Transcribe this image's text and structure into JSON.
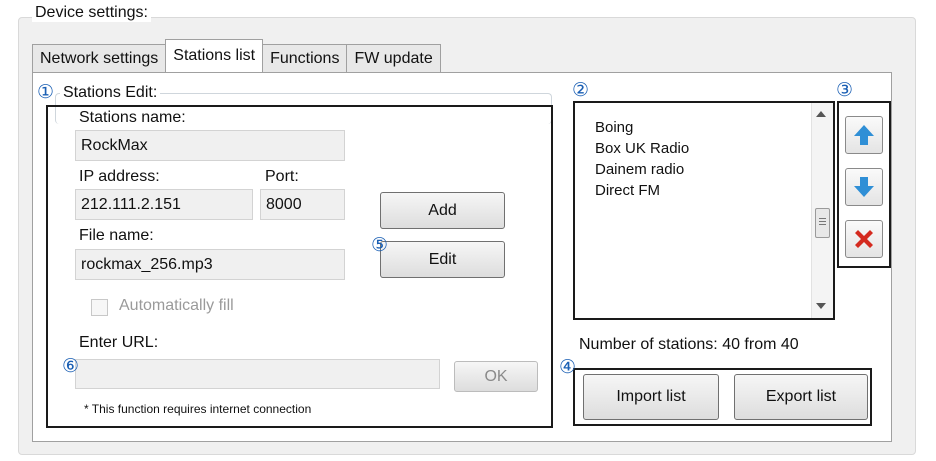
{
  "window": {
    "group_title": "Device settings:"
  },
  "tabs": [
    {
      "label": "Network settings",
      "active": false
    },
    {
      "label": "Stations list",
      "active": true
    },
    {
      "label": "Functions",
      "active": false
    },
    {
      "label": "FW update",
      "active": false
    }
  ],
  "markers": {
    "m1": "①",
    "m2": "②",
    "m3": "③",
    "m4": "④",
    "m5": "⑤",
    "m6": "⑥"
  },
  "edit": {
    "title": "Stations Edit:",
    "name_label": "Stations name:",
    "name_value": "RockMax",
    "ip_label": "IP address:",
    "ip_value": "212.111.2.151",
    "port_label": "Port:",
    "port_value": "8000",
    "file_label": "File name:",
    "file_value": "rockmax_256.mp3",
    "add_label": "Add",
    "edit_label": "Edit",
    "auto_fill_label": "Automatically fill",
    "auto_fill_checked": false,
    "url_label": "Enter URL:",
    "url_value": "",
    "ok_label": "OK",
    "note": "* This function requires internet connection"
  },
  "stations": {
    "items": [
      "Boing",
      "Box UK Radio",
      "Dainem radio",
      "Direct FM"
    ],
    "count_label": "Number of stations:",
    "count_value": "40 from 40",
    "import_label": "Import list",
    "export_label": "Export list"
  },
  "icons": {
    "up": "arrow-up-icon",
    "down": "arrow-down-icon",
    "delete": "delete-x-icon"
  },
  "colors": {
    "marker": "#1a5fb4",
    "arrow": "#2f8fd6",
    "delete": "#d42a1f"
  }
}
